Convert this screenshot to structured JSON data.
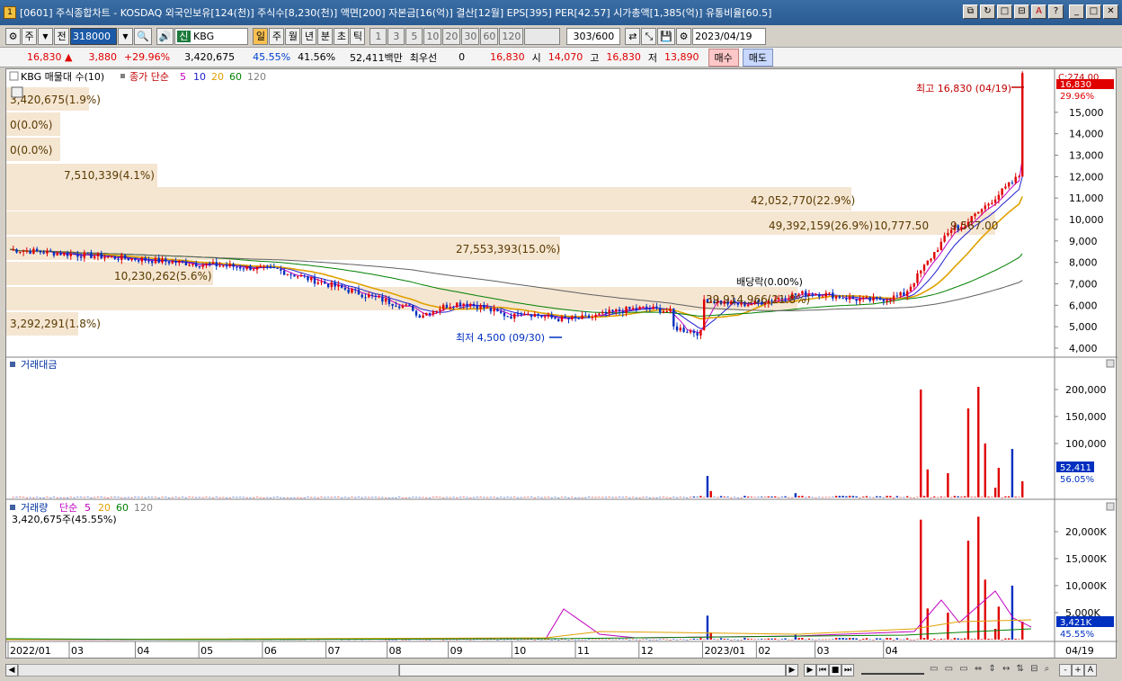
{
  "window": {
    "title": "[0601] 주식종합차트 - KOSDAQ 외국인보유[124(천)] 주식수[8,230(천)] 액면[200] 자본금[16(억)] 결산[12월] EPS[395] PER[42.57] 시가총액[1,385(억)] 유통비율[60.5]",
    "buttons": [
      "⧉",
      "↻",
      "□",
      "⊟",
      "A",
      "?",
      "_",
      "□",
      "✕"
    ]
  },
  "toolbar": {
    "type_label": "주",
    "prev_label": "전",
    "code": "318000",
    "badge": "신",
    "name": "KBG",
    "periods": [
      "일",
      "주",
      "월",
      "년",
      "분",
      "초",
      "틱"
    ],
    "intervals": [
      "1",
      "3",
      "5",
      "10",
      "20",
      "30",
      "60",
      "120"
    ],
    "page": "303/600",
    "date": "2023/04/19"
  },
  "info": {
    "price": "16,830",
    "change": "3,880",
    "change_pct": "+29.96%",
    "volume": "3,420,675",
    "ratio1": "45.55%",
    "ratio2": "41.56%",
    "amount": "52,411백만",
    "priority_label": "최우선",
    "priority_value": "0",
    "ask": "16,830",
    "open_label": "시",
    "open": "14,070",
    "high_label": "고",
    "high": "16,830",
    "low_label": "저",
    "low": "13,890",
    "buy_label": "매수",
    "sell_label": "매도"
  },
  "price_panel": {
    "legend_title": "KBG 매물대 수(10)",
    "ma_label": "종가 단순",
    "ma_periods": [
      "5",
      "10",
      "20",
      "60",
      "120"
    ],
    "ma_colors": [
      "#c000c0",
      "#2020d0",
      "#e0a000",
      "#008000",
      "#606060"
    ],
    "right_top": "C:274.00",
    "current_price": "16,830",
    "current_pct": "29.96%",
    "high_annot": "최고 16,830 (04/19)",
    "low_annot": "최저 4,500 (09/30)",
    "dividend_annot": "배당락(0.00%)",
    "y_ticks": [
      "15,000",
      "14,000",
      "13,000",
      "12,000",
      "11,000",
      "10,000",
      "9,000",
      "8,000",
      "7,000",
      "6,000",
      "5,000",
      "4,000"
    ],
    "volume_profile": [
      "3,420,675(1.9%)",
      "0(0.0%)",
      "0(0.0%)",
      "7,510,339(4.1%)",
      "42,052,770(22.9%)",
      "49,392,159(26.9%)",
      "27,553,393(15.0%)",
      "10,230,262(5.6%)",
      "39,914,966(21.8%)",
      "3,292,291(1.8%)"
    ],
    "extra_labels": [
      "10,777.50",
      "9,567.00"
    ]
  },
  "amount_panel": {
    "title": "거래대금",
    "y_ticks": [
      "200,000",
      "150,000",
      "100,000"
    ],
    "current": "52,411",
    "current_pct": "56.05%"
  },
  "volume_panel": {
    "title": "거래량",
    "ma_label": "단순",
    "ma_periods": [
      "5",
      "20",
      "60",
      "120"
    ],
    "value_label": "3,420,675주(45.55%)",
    "y_ticks": [
      "20,000K",
      "15,000K",
      "10,000K",
      "5,000K"
    ],
    "current": "3,421K",
    "current_pct": "45.55%"
  },
  "x_axis": [
    "2022/01",
    "03",
    "04",
    "05",
    "06",
    "07",
    "08",
    "09",
    "10",
    "11",
    "12",
    "2023/01",
    "02",
    "03",
    "04"
  ],
  "x_axis_right": "04/19",
  "bottom": {
    "left_arrow": "◀",
    "right_arrow": "▶",
    "controls": [
      "▶",
      "⏮",
      "■",
      "⏭"
    ],
    "zoom": [
      "-",
      "+",
      "A"
    ]
  }
}
